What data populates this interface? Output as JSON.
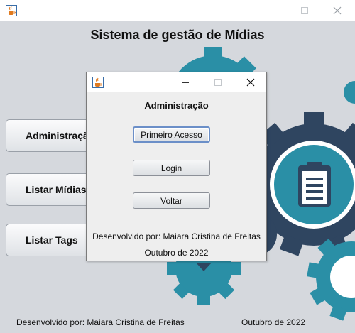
{
  "window": {
    "title": "",
    "icon": "java-cup-icon",
    "controls": [
      "minimize-icon",
      "maximize-icon",
      "close-icon"
    ]
  },
  "main": {
    "title": "Sistema de gestão de Mídias",
    "buttons": [
      {
        "label": "Administração"
      },
      {
        "label": "Listar Mídias"
      },
      {
        "label": "Listar Tags"
      }
    ],
    "illustration": {
      "icons": [
        "gear-icon",
        "clipboard-icon"
      ]
    },
    "footer": {
      "developer": "Desenvolvido por: Maiara Cristina de Freitas",
      "date": "Outubro de 2022"
    }
  },
  "dialog": {
    "title": "Administração",
    "buttons": [
      {
        "label": "Primeiro Acesso",
        "focused": true
      },
      {
        "label": "Login"
      },
      {
        "label": "Voltar"
      }
    ],
    "developer": "Desenvolvido por: Maiara Cristina de Freitas",
    "date": "Outubro de 2022"
  },
  "colors": {
    "gear_dark": "#2f4560",
    "gear_teal": "#2a8fa6",
    "gear_light": "#ffffff",
    "background": "#d5d8dd",
    "focus_border": "#6b8fc8"
  }
}
